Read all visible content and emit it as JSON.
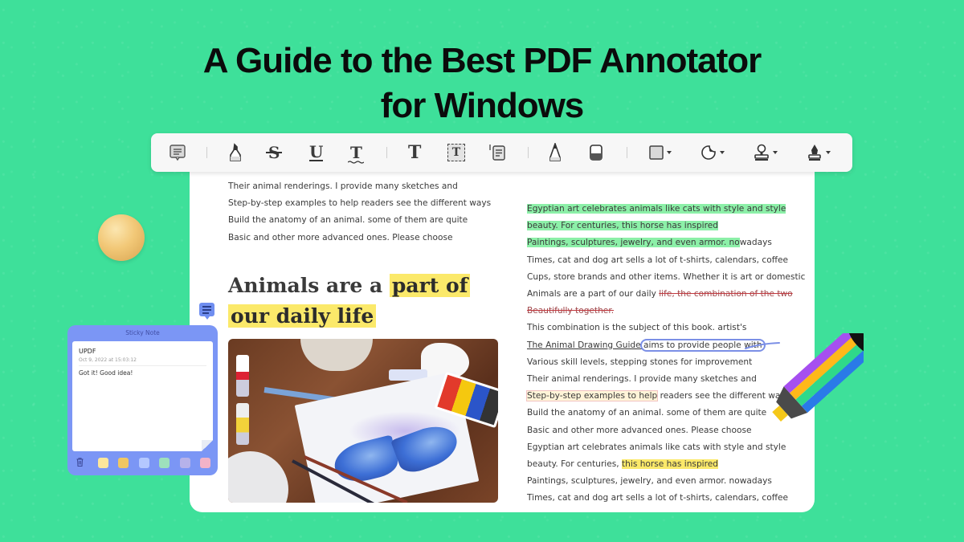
{
  "headline": {
    "line1": "A Guide to the Best PDF Annotator",
    "line2": "for Windows"
  },
  "toolbar": {
    "tools": [
      {
        "name": "comment",
        "icon": "comment-icon"
      },
      {
        "name": "highlight",
        "icon": "highlighter-icon"
      },
      {
        "name": "strikethrough",
        "icon": "strikethrough-icon",
        "glyph": "S"
      },
      {
        "name": "underline",
        "icon": "underline-icon",
        "glyph": "U"
      },
      {
        "name": "squiggly",
        "icon": "squiggly-underline-icon",
        "glyph": "T"
      },
      {
        "name": "text",
        "icon": "text-icon",
        "glyph": "T"
      },
      {
        "name": "text-box",
        "icon": "text-box-icon",
        "glyph": "T"
      },
      {
        "name": "text-callout",
        "icon": "text-callout-icon"
      },
      {
        "name": "pencil",
        "icon": "pencil-icon"
      },
      {
        "name": "eraser",
        "icon": "eraser-icon"
      },
      {
        "name": "shape",
        "icon": "rectangle-icon",
        "has_dropdown": true
      },
      {
        "name": "sticker",
        "icon": "sticker-icon",
        "has_dropdown": true
      },
      {
        "name": "stamp",
        "icon": "stamp-icon",
        "has_dropdown": true
      },
      {
        "name": "signature",
        "icon": "pen-nib-icon",
        "has_dropdown": true
      }
    ]
  },
  "document": {
    "left_column": {
      "lines": [
        "Their animal renderings. I provide many sketches and",
        "Step-by-step examples to help readers see the different ways",
        "Build the anatomy of an animal. some of them are quite",
        "Basic and other more advanced ones. Please choose"
      ],
      "heading_plain": "Animals are a ",
      "heading_highlight_1": "part of",
      "heading_highlight_2": "our daily life",
      "image_alt": "Watercolor butterfly painting on a table with paints and brushes"
    },
    "right_column": {
      "l1": "Egyptian art celebrates animals like cats with style and style",
      "l2": "beauty. For centuries, this horse has inspired",
      "l3_hl": "Paintings, sculptures, jewelry, and even armor. no",
      "l3_rest": "wadays",
      "l4": "Times, cat and dog art sells a lot of t-shirts, calendars, coffee",
      "l5": "Cups, store brands and other items. Whether it is art or domestic",
      "l6_plain": "Animals are a part of our daily ",
      "l6_strike": "life, the combination of the two",
      "l7_strike": "Beautifully together.",
      "l8": "This combination is the subject of this book. artist's",
      "l9_underline": "The Animal Drawing Guide ",
      "l9_circled": "aims to provide people with",
      "l10": "Various skill levels, stepping stones for improvement",
      "l11": "Their animal renderings. I provide many sketches and",
      "l12_boxed": "Step-by-step examples to help",
      "l12_rest": " readers see the different ways",
      "l13": "Build the anatomy of an animal. some of them are quite",
      "l14": "Basic and other more advanced ones. Please choose",
      "l15": "Egyptian art celebrates animals like cats with style and style",
      "l16_plain": "beauty. For centuries, ",
      "l16_hl": "this horse has inspired",
      "l17": "Paintings, sculptures, jewelry, and even armor. nowadays",
      "l18": "Times, cat and dog art sells a lot of t-shirts, calendars, coffee"
    }
  },
  "sticky_note": {
    "title": "Sticky Note",
    "author": "UPDF",
    "date": "Oct 9, 2022 at 15:03:12",
    "text": "Got it!  Good idea!",
    "colors": [
      "#fde79b",
      "#f0c762",
      "#b4c8ff",
      "#9ee0bc",
      "#b6b2ea",
      "#f2b3c8"
    ]
  },
  "colors": {
    "background": "#3ee09a",
    "highlight_green": "#8cf0a8",
    "highlight_yellow": "#fbe96a",
    "strike_red": "#c0393f",
    "circle_blue": "#7b8fe6",
    "sticky_blue": "#7b96f5"
  }
}
